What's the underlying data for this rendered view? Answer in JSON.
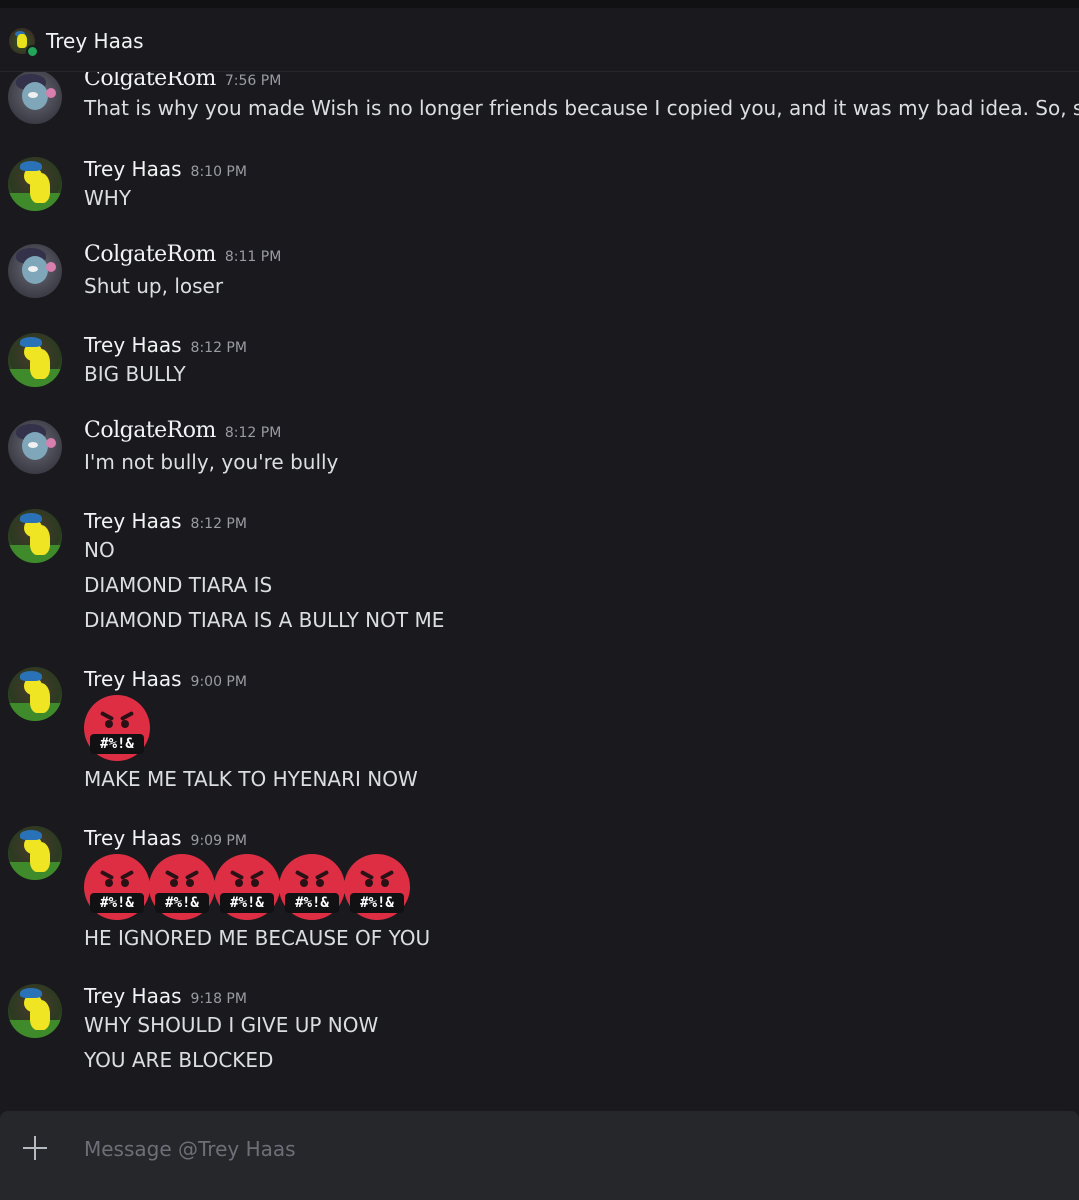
{
  "header": {
    "title": "Trey Haas",
    "status": "online"
  },
  "messages": [
    {
      "author": "ColgateRom",
      "time": "7:56 PM",
      "lines": [
        "That is why you made Wish is no longer friends because I copied you, and it was my bad idea. So, stop it."
      ]
    },
    {
      "author": "Trey Haas",
      "time": "8:10 PM",
      "lines": [
        "WHY"
      ]
    },
    {
      "author": "ColgateRom",
      "time": "8:11 PM",
      "lines": [
        "Shut up, loser"
      ]
    },
    {
      "author": "Trey Haas",
      "time": "8:12 PM",
      "lines": [
        "BIG BULLY"
      ]
    },
    {
      "author": "ColgateRom",
      "time": "8:12 PM",
      "lines": [
        "I'm not bully, you're bully"
      ]
    },
    {
      "author": "Trey Haas",
      "time": "8:12 PM",
      "lines": [
        "NO",
        "DIAMOND TIARA IS",
        "DIAMOND TIARA IS A BULLY NOT ME"
      ]
    },
    {
      "author": "Trey Haas",
      "time": "9:00 PM",
      "emoji": "#%!&",
      "emoji_count": 1,
      "lines": [
        "MAKE ME TALK TO HYENARI NOW"
      ]
    },
    {
      "author": "Trey Haas",
      "time": "9:09 PM",
      "emoji": "#%!&",
      "emoji_count": 5,
      "lines": [
        "HE IGNORED ME BECAUSE OF YOU"
      ]
    },
    {
      "author": "Trey Haas",
      "time": "9:18 PM",
      "lines": [
        "WHY SHOULD I GIVE UP NOW",
        "YOU ARE BLOCKED"
      ]
    }
  ],
  "composer": {
    "placeholder": "Message @Trey Haas"
  },
  "icons": {
    "add": "plus-icon",
    "emoji": "face-with-symbols-on-mouth-icon"
  },
  "colors": {
    "background": "#1a1a1e",
    "composer": "#26272b",
    "online": "#23a559",
    "emoji_face": "#dd2e44"
  }
}
